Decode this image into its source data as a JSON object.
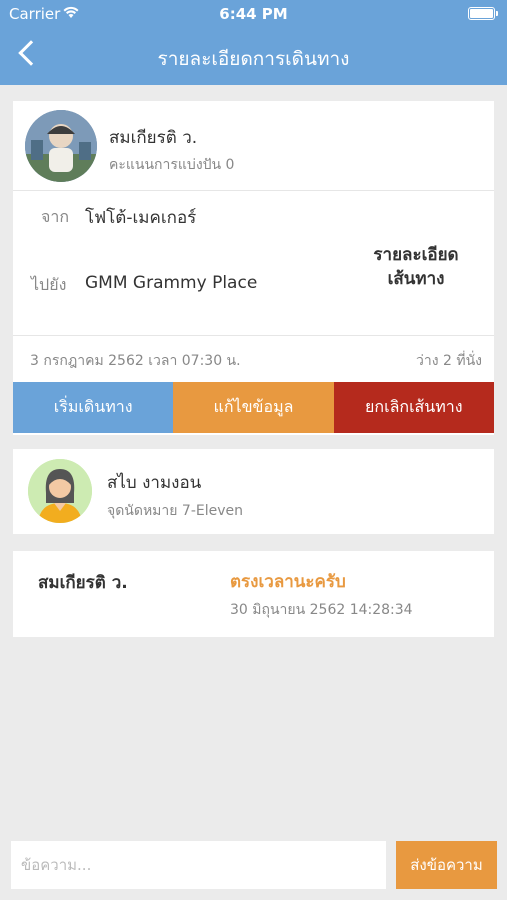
{
  "status_bar": {
    "carrier": "Carrier",
    "time": "6:44 PM"
  },
  "header": {
    "title": "รายละเอียดการเดินทาง",
    "back_icon": "chevron-left-icon"
  },
  "trip": {
    "driver_name": "สมเกียรติ ว.",
    "driver_score": "คะแนนการแบ่งปัน 0",
    "from_label": "จาก",
    "from_value": "โฟโต้-เมคเกอร์",
    "to_label": "ไปยัง",
    "to_value": "GMM Grammy Place",
    "route_details_line1": "รายละเอียด",
    "route_details_line2": "เส้นทาง",
    "date": "3 กรกฎาคม 2562 เวลา 07:30 น.",
    "seats": "ว่าง 2 ที่นั่ง"
  },
  "actions": {
    "start": "เริ่มเดินทาง",
    "edit": "แก้ไขข้อมูล",
    "cancel": "ยกเลิกเส้นทาง"
  },
  "passenger": {
    "name": "สไบ งามงอน",
    "meeting_point": "จุดนัดหมาย 7-Eleven"
  },
  "message": {
    "sender": "สมเกียรติ ว.",
    "text": "ตรงเวลานะครับ",
    "timestamp": "30 มิถุนายน 2562 14:28:34"
  },
  "chat": {
    "placeholder": "ข้อความ...",
    "send_label": "ส่งข้อความ"
  },
  "colors": {
    "primary": "#6aa3d9",
    "accent": "#e89940",
    "danger": "#b52a1d"
  }
}
